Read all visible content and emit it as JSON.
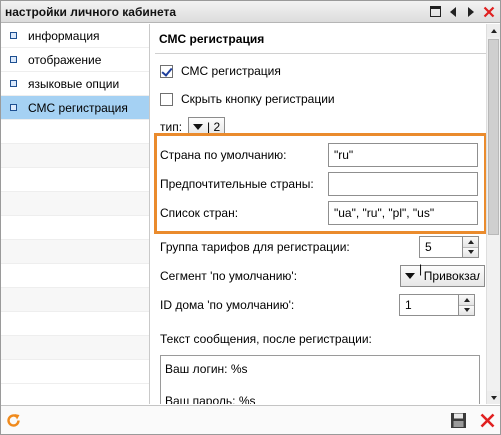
{
  "window": {
    "title": "настройки личного кабинета",
    "controls": [
      "maximize-icon",
      "prev-icon",
      "next-icon",
      "close-icon"
    ]
  },
  "sidebar": {
    "items": [
      {
        "label": "информация",
        "active": false
      },
      {
        "label": "отображение",
        "active": false
      },
      {
        "label": "языковые опции",
        "active": false
      },
      {
        "label": "СМС регистрация",
        "active": true
      }
    ]
  },
  "main": {
    "section_title": "СМС регистрация",
    "sms_registration": {
      "label": "СМС регистрация",
      "checked": true
    },
    "hide_register_button": {
      "label": "Скрыть кнопку регистрации",
      "checked": false
    },
    "type": {
      "label": "тип:",
      "value": "2"
    },
    "default_country": {
      "label": "Страна по умолчанию:",
      "value": "\"ru\""
    },
    "preferred_countries": {
      "label": "Предпочтительные страны:",
      "value": ""
    },
    "country_list": {
      "label": "Список стран:",
      "value": "\"ua\", \"ru\", \"pl\", \"us\""
    },
    "tariff_group": {
      "label": "Группа тарифов для регистрации:",
      "value": "5"
    },
    "default_segment": {
      "label": "Сегмент 'по умолчанию':",
      "value": "Привокзаль..."
    },
    "default_house_id": {
      "label": "ID дома 'по умолчанию':",
      "value": "1"
    },
    "message": {
      "label": "Текст сообщения, после регистрации:",
      "lines": [
        "Ваш логин: %s",
        "Ваш пароль: %s"
      ]
    }
  },
  "colors": {
    "highlight": "#ea8b2d",
    "active_item": "#a5d1f3",
    "close_red": "#e02020",
    "refresh_orange": "#f08a1c"
  }
}
